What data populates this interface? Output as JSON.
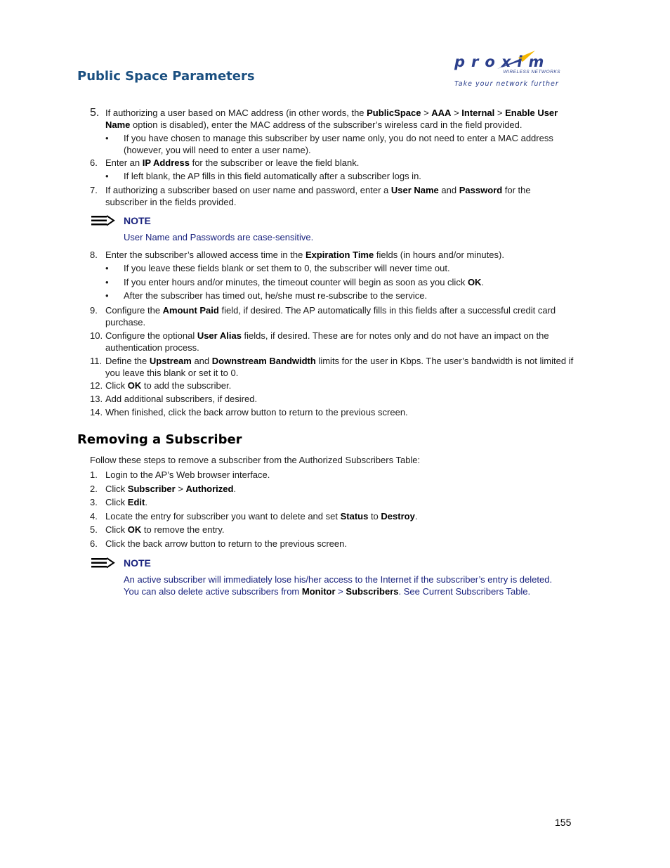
{
  "header": {
    "section_title": "Public Space Parameters",
    "logo": {
      "brand": "proxim",
      "subtitle": "WIRELESS NETWORKS",
      "tagline": "Take your network further",
      "brand_color": "#2b3f8c",
      "accent_color": "#f5b700"
    }
  },
  "steps_add": [
    {
      "num": "5.",
      "parts": [
        "If authorizing a user based on MAC address (in other words, the ",
        "PublicSpace",
        " > ",
        "AAA",
        " > ",
        "Internal",
        " > ",
        "Enable User Name",
        " option is disabled), enter the MAC address of the subscriber’s wireless card in the field provided."
      ]
    },
    {
      "num": "•",
      "text": "If you have chosen to manage this subscriber by user name only, you do not need to enter a MAC address (however, you will need to enter a user name)."
    },
    {
      "num": "6.",
      "parts": [
        "Enter an ",
        "IP Address",
        " for the subscriber or leave the field blank."
      ]
    },
    {
      "num": "•",
      "text": "If left blank, the AP fills in this field automatically after a subscriber logs in."
    },
    {
      "num": "7.",
      "parts": [
        "If authorizing a subscriber based on user name and password, enter a ",
        "User Name",
        " and ",
        "Password",
        " for the subscriber in the fields provided."
      ]
    },
    {
      "num": "8.",
      "parts": [
        "Enter the subscriber’s allowed access time in the ",
        "Expiration Time",
        " fields (in hours and/or minutes)."
      ]
    },
    {
      "num": "•",
      "text": "If you leave these fields blank or set them to 0, the subscriber will never time out."
    },
    {
      "num": "•",
      "parts": [
        "If you enter hours and/or minutes, the timeout counter will begin as soon as you click ",
        "OK",
        "."
      ]
    },
    {
      "num": "•",
      "text": "After the subscriber has timed out, he/she must re-subscribe to the service."
    },
    {
      "num": "9.",
      "parts": [
        "Configure the ",
        "Amount Paid",
        " field, if desired. The AP automatically fills in this fields after a successful credit card purchase."
      ]
    },
    {
      "num": "10.",
      "parts": [
        "Configure the optional ",
        "User Alias",
        " fields, if desired. These are for notes only and do not have an impact on the authentication process."
      ]
    },
    {
      "num": "11.",
      "parts": [
        "Define the ",
        "Upstream",
        " and ",
        "Downstream Bandwidth",
        " limits for the user in Kbps. The user’s bandwidth is not limited if you leave this blank or set it to 0."
      ]
    },
    {
      "num": "12.",
      "parts": [
        "Click ",
        "OK",
        " to add the subscriber."
      ]
    },
    {
      "num": "13.",
      "text": "Add additional subscribers, if desired."
    },
    {
      "num": "14.",
      "text": "When finished, click the back arrow button to return to the previous screen."
    }
  ],
  "note1": {
    "label": "NOTE",
    "text": "User Name and Passwords are case-sensitive."
  },
  "removing": {
    "title": "Removing a Subscriber",
    "intro": "Follow these steps to remove a subscriber from the Authorized Subscribers Table:",
    "steps": [
      {
        "num": "1.",
        "parts": [
          "Login to the AP’s Web browser interface."
        ]
      },
      {
        "num": "2.",
        "parts": [
          "Click ",
          "Subscriber",
          " > ",
          "Authorized",
          "."
        ]
      },
      {
        "num": "3.",
        "parts": [
          "Click ",
          "Edit",
          "."
        ]
      },
      {
        "num": "4.",
        "parts": [
          "Locate the entry for subscriber you want to delete and set ",
          "Status",
          " to ",
          "Destroy",
          "."
        ]
      },
      {
        "num": "5.",
        "parts": [
          "Click ",
          "OK",
          " to remove the entry."
        ]
      },
      {
        "num": "6.",
        "parts": [
          "Click the back arrow button to return to the previous screen."
        ]
      }
    ]
  },
  "note2": {
    "label": "NOTE",
    "line1": "An active subscriber will immediately lose his/her access to the Internet if the subscriber’s entry is deleted.",
    "line2_pre": "You can also delete active subscribers from ",
    "line2_b1": "Monitor",
    "line2_sep": " > ",
    "line2_b2": "Subscribers",
    "line2_mid": ". See ",
    "line2_link": "Current Subscribers Table",
    "line2_end": "."
  },
  "footer": {
    "page_number": "155"
  }
}
